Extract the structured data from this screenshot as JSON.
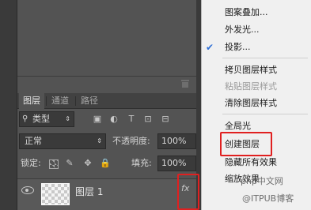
{
  "layers_panel": {
    "tabs": [
      "图层",
      "通道",
      "路径"
    ],
    "filter_type": "类型",
    "filter_icons": [
      "image-filter-icon",
      "adjustment-filter-icon",
      "type-filter-icon",
      "shape-filter-icon",
      "smart-object-filter-icon"
    ],
    "blend_mode": "正常",
    "opacity_label": "不透明度:",
    "opacity_value": "100%",
    "lock_label": "锁定:",
    "lock_icons": [
      "lock-transparent-icon",
      "lock-image-icon",
      "lock-position-icon",
      "lock-all-icon"
    ],
    "fill_label": "填充:",
    "fill_value": "100%",
    "layer": {
      "name": "图层 1",
      "fx": "fx"
    }
  },
  "context_menu": {
    "items": [
      {
        "label": "图案叠加...",
        "checked": false,
        "disabled": false
      },
      {
        "label": "外发光...",
        "checked": false,
        "disabled": false
      },
      {
        "label": "投影...",
        "checked": true,
        "disabled": false
      },
      {
        "label": "拷贝图层样式",
        "checked": false,
        "disabled": false
      },
      {
        "label": "粘贴图层样式",
        "checked": false,
        "disabled": true
      },
      {
        "label": "清除图层样式",
        "checked": false,
        "disabled": false
      },
      {
        "label": "全局光",
        "checked": false,
        "disabled": false
      },
      {
        "label": "创建图层",
        "checked": false,
        "disabled": false
      },
      {
        "label": "隐藏所有效果",
        "checked": false,
        "disabled": false
      },
      {
        "label": "缩放效果",
        "checked": false,
        "disabled": false
      }
    ],
    "check_mark": "✔"
  },
  "watermark": {
    "line1": "php中文网",
    "line2": "@ITPUB博客"
  },
  "colors": {
    "panel": "#535353",
    "menu_bg": "#f0f0f0",
    "highlight": "#e02020",
    "check": "#2e6fd6"
  }
}
